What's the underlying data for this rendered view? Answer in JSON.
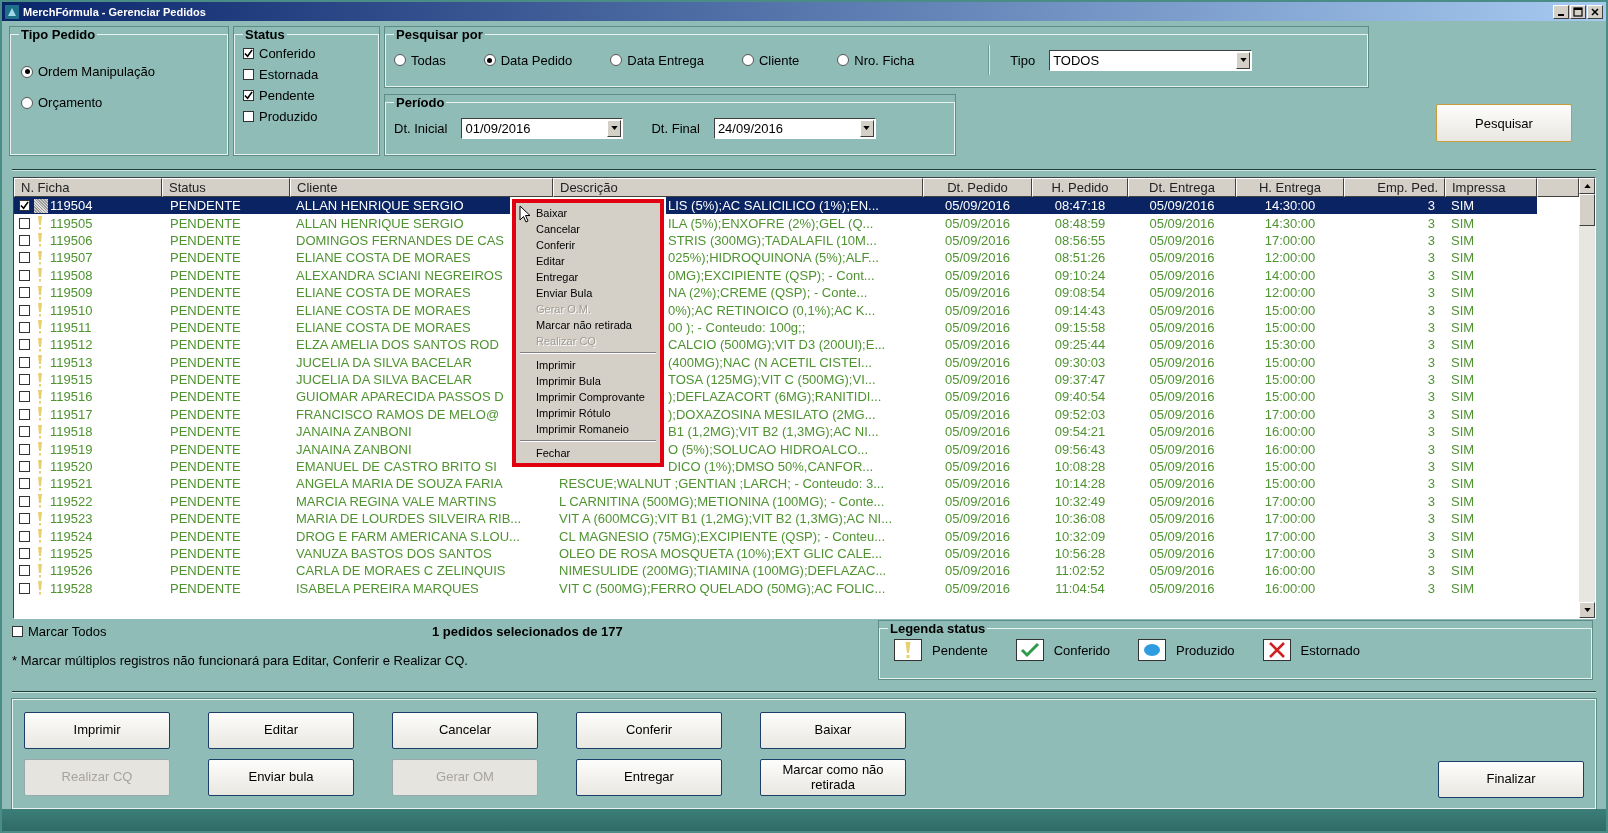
{
  "window": {
    "title": "MerchFórmula - Gerenciar Pedidos"
  },
  "tipo_pedido": {
    "title": "Tipo Pedido",
    "options": [
      {
        "label": "Ordem Manipulação",
        "selected": true
      },
      {
        "label": "Orçamento",
        "selected": false
      }
    ]
  },
  "status_filter": {
    "title": "Status",
    "options": [
      {
        "label": "Conferido",
        "checked": true
      },
      {
        "label": "Estornada",
        "checked": false
      },
      {
        "label": "Pendente",
        "checked": true
      },
      {
        "label": "Produzido",
        "checked": false
      }
    ]
  },
  "pesquisar_por": {
    "title": "Pesquisar por",
    "options": [
      {
        "label": "Todas",
        "selected": false
      },
      {
        "label": "Data Pedido",
        "selected": true
      },
      {
        "label": "Data Entrega",
        "selected": false
      },
      {
        "label": "Cliente",
        "selected": false
      },
      {
        "label": "Nro. Ficha",
        "selected": false
      }
    ],
    "tipo_label": "Tipo",
    "tipo_value": "TODOS"
  },
  "periodo": {
    "title": "Período",
    "start_label": "Dt. Inicial",
    "start_value": "01/09/2016",
    "end_label": "Dt. Final",
    "end_value": "24/09/2016"
  },
  "search_button": "Pesquisar",
  "table": {
    "columns": [
      "N. Ficha",
      "Status",
      "Cliente",
      "Descrição",
      "Dt. Pedido",
      "H. Pedido",
      "Dt. Entrega",
      "H. Entrega",
      "Emp. Ped.",
      "Impressa"
    ],
    "rows": [
      {
        "checked": true,
        "selected": true,
        "cells": [
          "119504",
          "PENDENTE",
          "ALLAN HENRIQUE SERGIO",
          "LIS (5%);AC SALICILICO (1%);EN...",
          "05/09/2016",
          "08:47:18",
          "05/09/2016",
          "14:30:00",
          "3",
          "SIM"
        ]
      },
      {
        "checked": false,
        "selected": false,
        "cells": [
          "119505",
          "PENDENTE",
          "ALLAN HENRIQUE SERGIO",
          "ILA (5%);ENXOFRE (2%);GEL (Q...",
          "05/09/2016",
          "08:48:59",
          "05/09/2016",
          "14:30:00",
          "3",
          "SIM"
        ]
      },
      {
        "checked": false,
        "selected": false,
        "cells": [
          "119506",
          "PENDENTE",
          "DOMINGOS FERNANDES DE CAS",
          "STRIS (300MG);TADALAFIL (10M...",
          "05/09/2016",
          "08:56:55",
          "05/09/2016",
          "17:00:00",
          "3",
          "SIM"
        ]
      },
      {
        "checked": false,
        "selected": false,
        "cells": [
          "119507",
          "PENDENTE",
          "ELIANE COSTA DE MORAES",
          "025%);HIDROQUINONA (5%);ALF...",
          "05/09/2016",
          "08:51:26",
          "05/09/2016",
          "12:00:00",
          "3",
          "SIM"
        ]
      },
      {
        "checked": false,
        "selected": false,
        "cells": [
          "119508",
          "PENDENTE",
          "ALEXANDRA SCIANI NEGREIROS",
          "0MG);EXCIPIENTE (QSP); -  Cont...",
          "05/09/2016",
          "09:10:24",
          "05/09/2016",
          "14:00:00",
          "3",
          "SIM"
        ]
      },
      {
        "checked": false,
        "selected": false,
        "cells": [
          "119509",
          "PENDENTE",
          "ELIANE COSTA DE MORAES",
          "NA (2%);CREME (QSP); -  Conte...",
          "05/09/2016",
          "09:08:54",
          "05/09/2016",
          "12:00:00",
          "3",
          "SIM"
        ]
      },
      {
        "checked": false,
        "selected": false,
        "cells": [
          "119510",
          "PENDENTE",
          "ELIANE COSTA DE MORAES",
          "0%);AC RETINOICO (0,1%);AC K...",
          "05/09/2016",
          "09:14:43",
          "05/09/2016",
          "15:00:00",
          "3",
          "SIM"
        ]
      },
      {
        "checked": false,
        "selected": false,
        "cells": [
          "119511",
          "PENDENTE",
          "ELIANE COSTA DE MORAES",
          "00    ); -  Conteudo: 100g;;",
          "05/09/2016",
          "09:15:58",
          "05/09/2016",
          "15:00:00",
          "3",
          "SIM"
        ]
      },
      {
        "checked": false,
        "selected": false,
        "cells": [
          "119512",
          "PENDENTE",
          "ELZA AMELIA DOS SANTOS ROD",
          "CALCIO (500MG);VIT D3 (200UI);E...",
          "05/09/2016",
          "09:25:44",
          "05/09/2016",
          "15:30:00",
          "3",
          "SIM"
        ]
      },
      {
        "checked": false,
        "selected": false,
        "cells": [
          "119513",
          "PENDENTE",
          "JUCELIA DA SILVA BACELAR",
          "(400MG);NAC (N ACETIL CISTEI...",
          "05/09/2016",
          "09:30:03",
          "05/09/2016",
          "15:00:00",
          "3",
          "SIM"
        ]
      },
      {
        "checked": false,
        "selected": false,
        "cells": [
          "119515",
          "PENDENTE",
          "JUCELIA DA SILVA BACELAR",
          "TOSA (125MG);VIT C (500MG);VI...",
          "05/09/2016",
          "09:37:47",
          "05/09/2016",
          "15:00:00",
          "3",
          "SIM"
        ]
      },
      {
        "checked": false,
        "selected": false,
        "cells": [
          "119516",
          "PENDENTE",
          "GUIOMAR APARECIDA PASSOS D",
          ");DEFLAZACORT (6MG);RANITIDI...",
          "05/09/2016",
          "09:40:54",
          "05/09/2016",
          "15:00:00",
          "3",
          "SIM"
        ]
      },
      {
        "checked": false,
        "selected": false,
        "cells": [
          "119517",
          "PENDENTE",
          "FRANCISCO RAMOS DE MELO@",
          ");DOXAZOSINA MESILATO (2MG...",
          "05/09/2016",
          "09:52:03",
          "05/09/2016",
          "17:00:00",
          "3",
          "SIM"
        ]
      },
      {
        "checked": false,
        "selected": false,
        "cells": [
          "119518",
          "PENDENTE",
          "JANAINA ZANBONI",
          "B1 (1,2MG);VIT B2 (1,3MG);AC NI...",
          "05/09/2016",
          "09:54:21",
          "05/09/2016",
          "16:00:00",
          "3",
          "SIM"
        ]
      },
      {
        "checked": false,
        "selected": false,
        "cells": [
          "119519",
          "PENDENTE",
          "JANAINA ZANBONI",
          "O (5%);SOLUCAO HIDROALCO...",
          "05/09/2016",
          "09:56:43",
          "05/09/2016",
          "16:00:00",
          "3",
          "SIM"
        ]
      },
      {
        "checked": false,
        "selected": false,
        "cells": [
          "119520",
          "PENDENTE",
          "EMANUEL DE CASTRO BRITO SI",
          "DICO (1%);DMSO 50%,CANFOR...",
          "05/09/2016",
          "10:08:28",
          "05/09/2016",
          "15:00:00",
          "3",
          "SIM"
        ]
      },
      {
        "checked": false,
        "selected": false,
        "cells": [
          "119521",
          "PENDENTE",
          "ANGELA MARIA DE SOUZA FARIA",
          "RESCUE;WALNUT ;GENTIAN ;LARCH; -  Conteudo: 3...",
          "05/09/2016",
          "10:14:28",
          "05/09/2016",
          "15:00:00",
          "3",
          "SIM"
        ]
      },
      {
        "checked": false,
        "selected": false,
        "cells": [
          "119522",
          "PENDENTE",
          "MARCIA REGINA VALE MARTINS",
          "L CARNITINA (500MG);METIONINA (100MG); -  Conte...",
          "05/09/2016",
          "10:32:49",
          "05/09/2016",
          "17:00:00",
          "3",
          "SIM"
        ]
      },
      {
        "checked": false,
        "selected": false,
        "cells": [
          "119523",
          "PENDENTE",
          "MARIA DE LOURDES SILVEIRA RIB...",
          "VIT A (600MCG);VIT B1 (1,2MG);VIT B2 (1,3MG);AC NI...",
          "05/09/2016",
          "10:36:08",
          "05/09/2016",
          "17:00:00",
          "3",
          "SIM"
        ]
      },
      {
        "checked": false,
        "selected": false,
        "cells": [
          "119524",
          "PENDENTE",
          "DROG E FARM AMERICANA S.LOU...",
          "CL MAGNESIO (75MG);EXCIPIENTE (QSP); -  Conteu...",
          "05/09/2016",
          "10:32:09",
          "05/09/2016",
          "17:00:00",
          "3",
          "SIM"
        ]
      },
      {
        "checked": false,
        "selected": false,
        "cells": [
          "119525",
          "PENDENTE",
          "VANUZA BASTOS DOS SANTOS",
          "OLEO DE ROSA MOSQUETA (10%);EXT GLIC CALE...",
          "05/09/2016",
          "10:56:28",
          "05/09/2016",
          "17:00:00",
          "3",
          "SIM"
        ]
      },
      {
        "checked": false,
        "selected": false,
        "cells": [
          "119526",
          "PENDENTE",
          "CARLA DE MORAES C ZELINQUIS",
          "NIMESULIDE (200MG);TIAMINA (100MG);DEFLAZAC...",
          "05/09/2016",
          "11:02:52",
          "05/09/2016",
          "16:00:00",
          "3",
          "SIM"
        ]
      },
      {
        "checked": false,
        "selected": false,
        "cells": [
          "119528",
          "PENDENTE",
          "ISABELA PEREIRA MARQUES",
          "VIT C (500MG);FERRO QUELADO (50MG);AC FOLIC...",
          "05/09/2016",
          "11:04:54",
          "05/09/2016",
          "16:00:00",
          "3",
          "SIM"
        ]
      }
    ]
  },
  "context_menu": {
    "items": [
      {
        "kind": "item",
        "label": "Baixar",
        "disabled": false
      },
      {
        "kind": "item",
        "label": "Cancelar",
        "disabled": false
      },
      {
        "kind": "item",
        "label": "Conferir",
        "disabled": false
      },
      {
        "kind": "item",
        "label": "Editar",
        "disabled": false
      },
      {
        "kind": "item",
        "label": "Entregar",
        "disabled": false
      },
      {
        "kind": "item",
        "label": "Enviar Bula",
        "disabled": false
      },
      {
        "kind": "item",
        "label": "Gerar O.M.",
        "disabled": true
      },
      {
        "kind": "item",
        "label": "Marcar não retirada",
        "disabled": false
      },
      {
        "kind": "item",
        "label": "Realizar CQ",
        "disabled": true
      },
      {
        "kind": "separator"
      },
      {
        "kind": "item",
        "label": "Imprimir",
        "disabled": false
      },
      {
        "kind": "item",
        "label": "Imprimir Bula",
        "disabled": false
      },
      {
        "kind": "item",
        "label": "Imprimir Comprovante",
        "disabled": false
      },
      {
        "kind": "item",
        "label": "Imprimir Rótulo",
        "disabled": false
      },
      {
        "kind": "item",
        "label": "Imprimir Romaneio",
        "disabled": false
      },
      {
        "kind": "separator"
      },
      {
        "kind": "item",
        "label": "Fechar",
        "disabled": false
      }
    ]
  },
  "marcar_todos": {
    "label": "Marcar Todos",
    "checked": false
  },
  "selection_count": "1 pedidos selecionados de 177",
  "note": "* Marcar múltiplos registros não funcionará para Editar, Conferir e Realizar CQ.",
  "legend": {
    "title": "Legenda status",
    "items": [
      {
        "kind": "pendente",
        "label": "Pendente"
      },
      {
        "kind": "conferido",
        "label": "Conferido"
      },
      {
        "kind": "produzido",
        "label": "Produzido"
      },
      {
        "kind": "estornado",
        "label": "Estornado"
      }
    ]
  },
  "buttons": [
    [
      {
        "label": "Imprimir",
        "disabled": false
      },
      {
        "label": "Editar",
        "disabled": false
      },
      {
        "label": "Cancelar",
        "disabled": false
      },
      {
        "label": "Conferir",
        "disabled": false
      },
      {
        "label": "Baixar",
        "disabled": false
      }
    ],
    [
      {
        "label": "Realizar CQ",
        "disabled": true
      },
      {
        "label": "Enviar bula",
        "disabled": false
      },
      {
        "label": "Gerar OM",
        "disabled": true
      },
      {
        "label": "Entregar",
        "disabled": false
      },
      {
        "label": "Marcar como não retirada",
        "disabled": false
      }
    ]
  ],
  "finish_button": "Finalizar"
}
